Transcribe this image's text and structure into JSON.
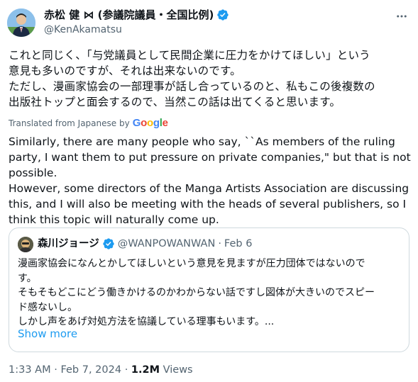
{
  "author": {
    "name": "赤松 健 ⋈ (参議院議員・全国比例)",
    "handle": "@KenAkamatsu",
    "verified_icon": "verified-badge-icon",
    "accent_color": "#1d9bf0"
  },
  "tweet": {
    "text_jp": "これと同じく、「与党議員として民間企業に圧力をかけてほしい」という\n意見も多いのですが、それは出来ないのです。\nただし、漫画家協会の一部理事が話し合っているのと、私もこの後複数の\n出版社トップと面会するので、当然この話は出てくると思います。",
    "translated_label": "Translated from Japanese by",
    "translated_brand": "Google",
    "text_en": "Similarly, there are many people who say, ``As members of the ruling\nparty, I want them to put pressure on private companies,\" but that is not\npossible.\nHowever, some directors of the Manga Artists Association are discussing\nthis, and I will also be meeting with the heads of several publishers, so I\nthink this topic will naturally come up."
  },
  "quote": {
    "name": "森川ジョージ",
    "handle": "@WANPOWANWAN",
    "sep": "·",
    "date": "Feb 6",
    "text": "漫画家協会になんとかしてほしいという意見を見ますが圧力団体ではないので\nす。\nそもそもどこにどう働きかけるのかわからない話ですし図体が大きいのでスピー\nド感ないし。\nしかし声をあげ対処方法を協議している理事もいます。...",
    "show_more": "Show more"
  },
  "meta": {
    "time": "1:33 AM",
    "sep1": "·",
    "date": "Feb 7, 2024",
    "sep2": "·",
    "views_count": "1.2M",
    "views_label": "Views"
  }
}
